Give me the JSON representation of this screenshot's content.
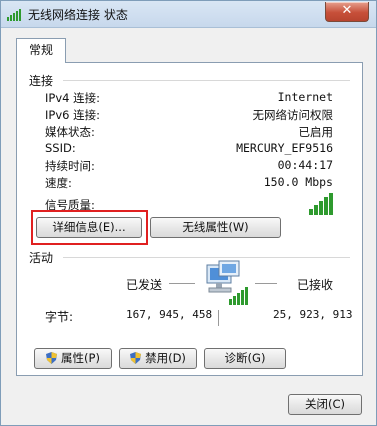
{
  "window": {
    "title": "无线网络连接 状态",
    "close_label": "✕"
  },
  "tab": {
    "label": "常规"
  },
  "connection": {
    "section_title": "连接",
    "rows": [
      {
        "label": "IPv4 连接:",
        "value": "Internet"
      },
      {
        "label": "IPv6 连接:",
        "value": "无网络访问权限"
      },
      {
        "label": "媒体状态:",
        "value": "已启用"
      },
      {
        "label": "SSID:",
        "value": "MERCURY_EF9516"
      },
      {
        "label": "持续时间:",
        "value": "00:44:17"
      },
      {
        "label": "速度:",
        "value": "150.0 Mbps"
      }
    ],
    "signal_label": "信号质量:",
    "details_button": "详细信息(E)...",
    "wireless_button": "无线属性(W)"
  },
  "activity": {
    "section_title": "活动",
    "sent_label": "已发送",
    "received_label": "已接收",
    "bytes_label": "字节:",
    "sent_value": "167, 945, 458",
    "received_value": "25, 923, 913"
  },
  "actions": {
    "properties": "属性(P)",
    "disable": "禁用(D)",
    "diagnose": "诊断(G)"
  },
  "footer": {
    "close": "关闭(C)"
  },
  "colors": {
    "signal_green": "#2e9a2e",
    "highlight_red": "#e02020",
    "close_red": "#c7503a"
  }
}
